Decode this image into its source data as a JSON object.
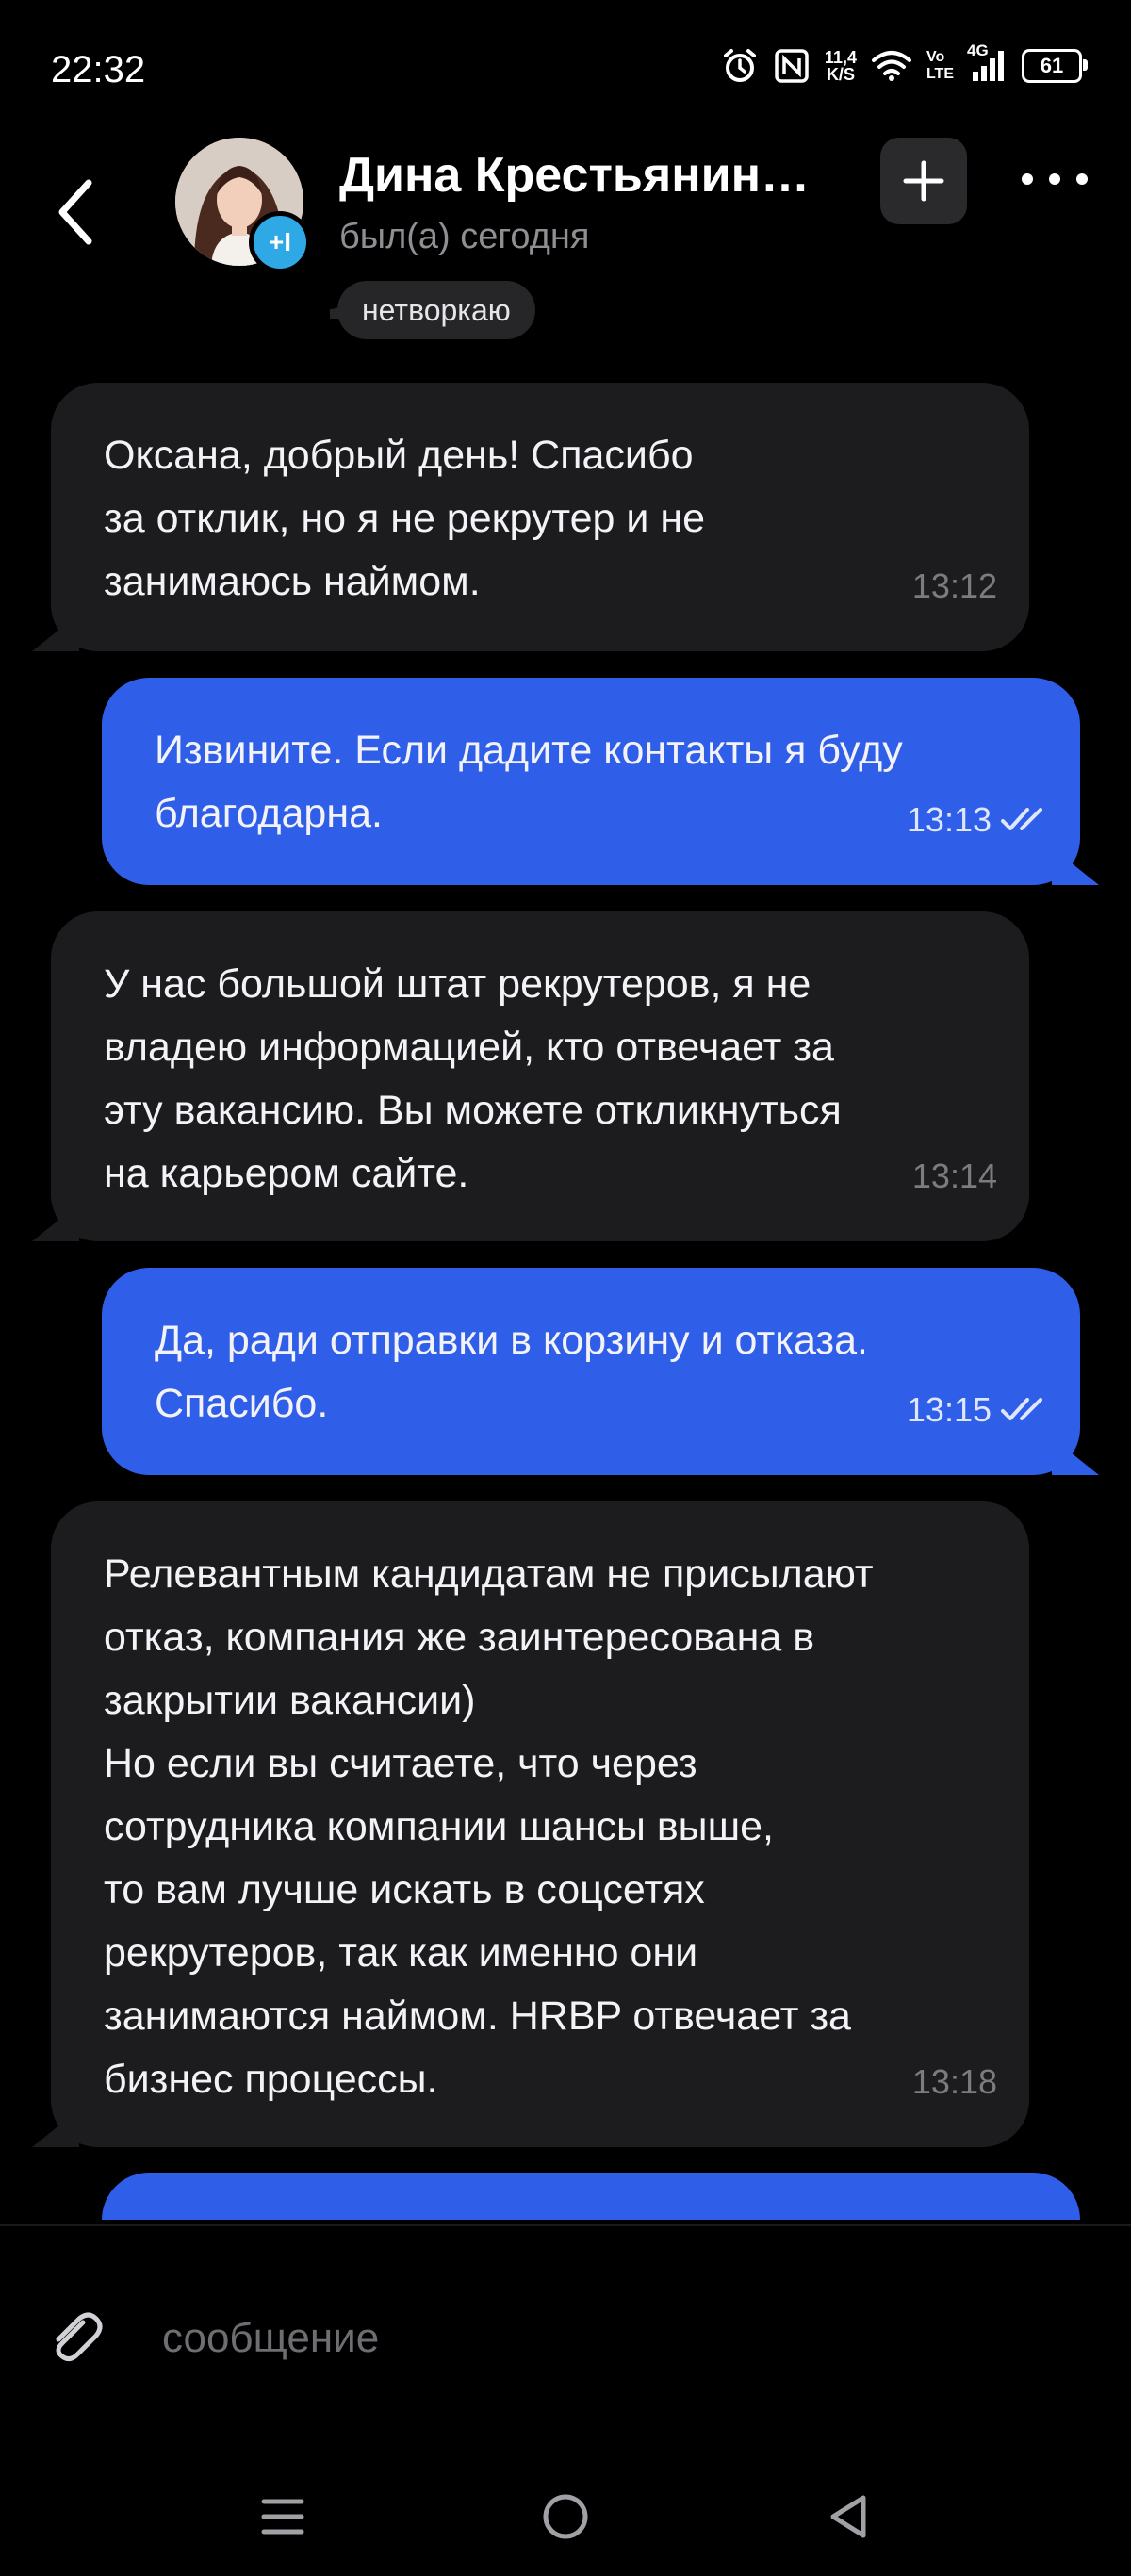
{
  "status_bar": {
    "time": "22:32",
    "net_speed_value": "11,4",
    "net_speed_unit": "K/S",
    "volte_top": "Vo",
    "volte_bottom": "LTE",
    "signal_label": "4G",
    "battery": "61"
  },
  "header": {
    "name": "Дина Крестьянин…",
    "status": "был(а) сегодня",
    "tag": "нетворкаю",
    "add_badge": "+I"
  },
  "messages": [
    {
      "dir": "in",
      "text": "Оксана, добрый день! Спасибо\nза отклик, но я не рекрутер и не\nзанимаюсь наймом.",
      "time": "13:12"
    },
    {
      "dir": "out",
      "text": "Извините. Если дадите контакты я буду\nблагодарна.",
      "time": "13:13"
    },
    {
      "dir": "in",
      "text": "У нас большой штат рекрутеров, я не\nвладею информацией, кто отвечает за\nэту вакансию. Вы можете откликнуться\nна карьером сайте.",
      "time": "13:14"
    },
    {
      "dir": "out",
      "text": "Да, ради отправки в корзину и отказа.\nСпасибо.",
      "time": "13:15"
    },
    {
      "dir": "in",
      "text": "Релевантным кандидатам не присылают\nотказ, компания же заинтересована в\nзакрытии вакансии)\nНо если вы считаете, что через\nсотрудника компании шансы выше,\nто вам лучше искать в соцсетях\nрекрутеров, так как именно они\nзанимаются наймом. HRBP отвечает за\nбизнес процессы.",
      "time": "13:18"
    },
    {
      "dir": "out",
      "text": "",
      "time": ""
    }
  ],
  "composer": {
    "placeholder": "сообщение"
  },
  "colors": {
    "incoming_bubble": "#1c1c1e",
    "outgoing_bubble": "#2f5ee8",
    "background": "#000000"
  },
  "icons": {
    "back": "chevron-left-icon",
    "add": "plus-icon",
    "more": "more-horizontal-icon",
    "attach": "paperclip-icon",
    "read": "double-check-icon",
    "nav_menu": "menu-icon",
    "nav_home": "home-circle-icon",
    "nav_back": "back-triangle-icon"
  }
}
